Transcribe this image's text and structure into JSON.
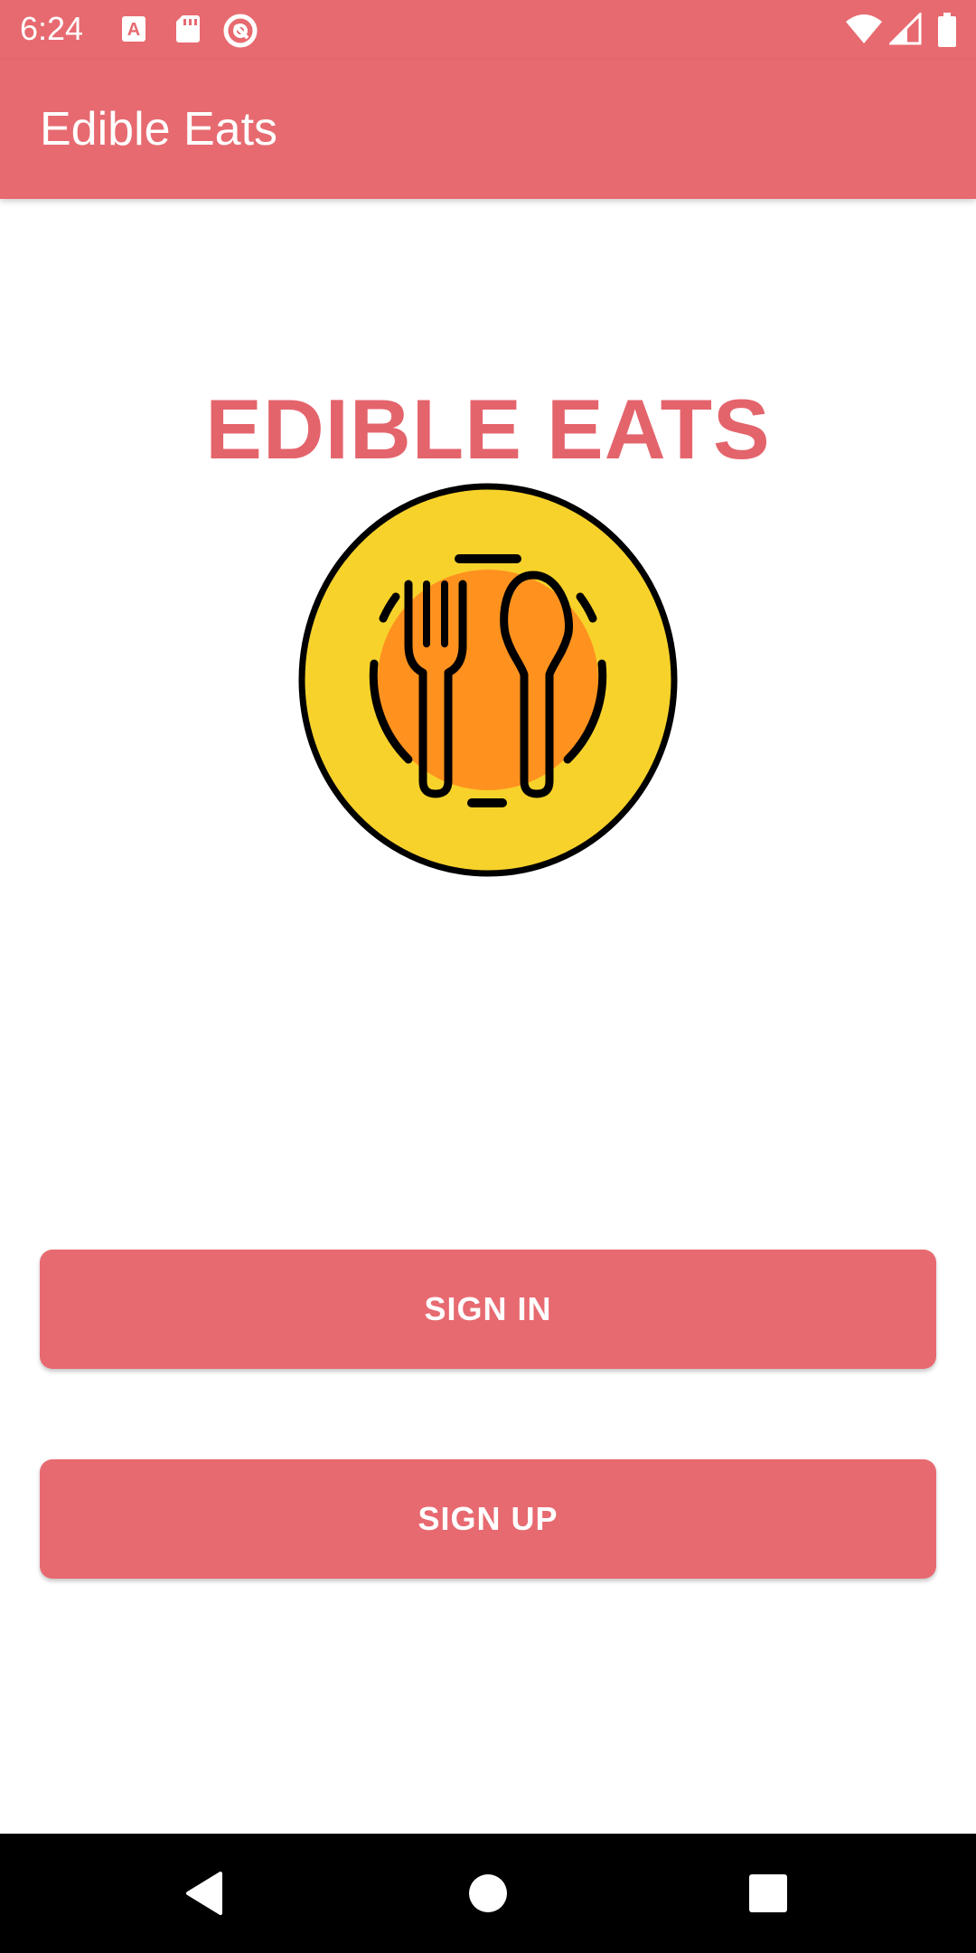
{
  "status_bar": {
    "time": "6:24",
    "icons": [
      "a-notification-icon",
      "sd-card-icon",
      "at-sign-icon",
      "wifi-icon",
      "cell-signal-icon",
      "battery-icon"
    ]
  },
  "app_bar": {
    "title": "Edible Eats"
  },
  "hero": {
    "title": "EDIBLE EATS",
    "logo_icon": "plate-fork-spoon-icon"
  },
  "buttons": {
    "sign_in": "SIGN IN",
    "sign_up": "SIGN UP"
  },
  "nav_bar": {
    "icons": [
      "back-icon",
      "home-icon",
      "recents-icon"
    ]
  },
  "colors": {
    "primary": "#e76a70",
    "title": "#e4646c",
    "logo_yellow": "#f7d22b",
    "logo_orange": "#ff921e",
    "nav_background": "#000000"
  }
}
